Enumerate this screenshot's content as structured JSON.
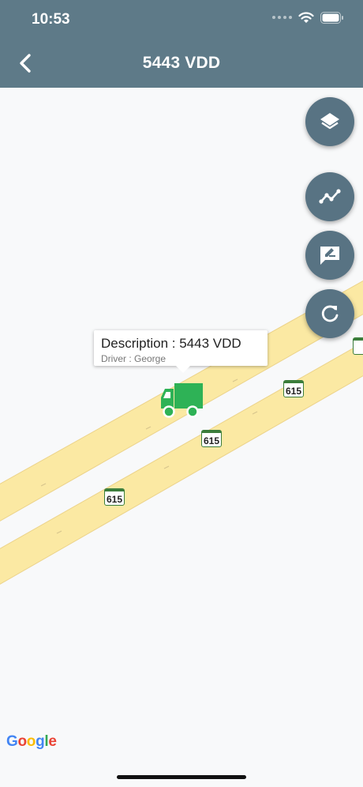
{
  "status_bar": {
    "time": "10:53"
  },
  "header": {
    "title": "5443 VDD"
  },
  "map": {
    "callout": {
      "description": "Description : 5443 VDD",
      "driver": "Driver : George"
    },
    "route_shields": [
      "615",
      "615",
      "615"
    ],
    "attribution": "Google",
    "road_color": "#fbe9a3",
    "vehicle_color": "#2eb256"
  },
  "fabs": [
    {
      "name": "layers-button",
      "icon": "layers-icon"
    },
    {
      "name": "route-history-button",
      "icon": "line-chart-icon"
    },
    {
      "name": "message-button",
      "icon": "message-edit-icon"
    },
    {
      "name": "refresh-button",
      "icon": "refresh-icon"
    }
  ]
}
